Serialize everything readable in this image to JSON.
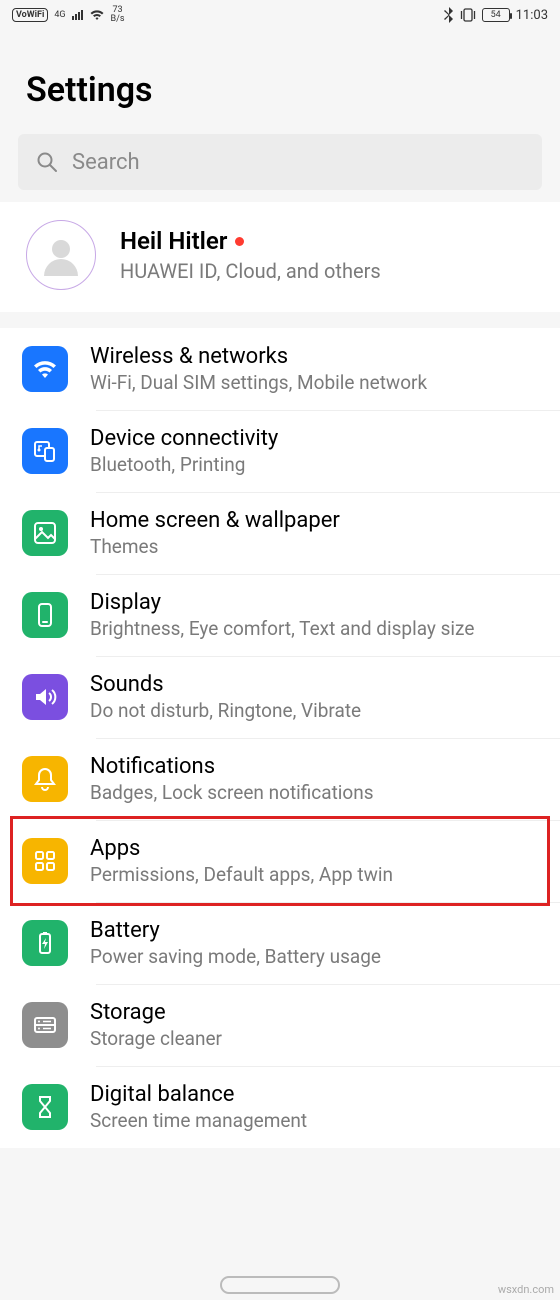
{
  "status": {
    "volte": "VoWiFi",
    "net_label": "4G",
    "speed_value": "73",
    "speed_unit": "B/s",
    "battery": "54",
    "time": "11:03"
  },
  "title": "Settings",
  "search": {
    "placeholder": "Search"
  },
  "account": {
    "name": "Heil Hitler",
    "subtitle": "HUAWEI ID, Cloud, and others"
  },
  "items": [
    {
      "id": "wireless",
      "icon": "wifi-icon",
      "color": "#1976ff",
      "title": "Wireless & networks",
      "subtitle": "Wi-Fi, Dual SIM settings, Mobile network"
    },
    {
      "id": "device-connectivity",
      "icon": "device-connectivity-icon",
      "color": "#1976ff",
      "title": "Device connectivity",
      "subtitle": "Bluetooth, Printing"
    },
    {
      "id": "home-screen",
      "icon": "wallpaper-icon",
      "color": "#21b36b",
      "title": "Home screen & wallpaper",
      "subtitle": "Themes"
    },
    {
      "id": "display",
      "icon": "display-icon",
      "color": "#21b36b",
      "title": "Display",
      "subtitle": "Brightness, Eye comfort, Text and display size"
    },
    {
      "id": "sounds",
      "icon": "sounds-icon",
      "color": "#7b4fe0",
      "title": "Sounds",
      "subtitle": "Do not disturb, Ringtone, Vibrate"
    },
    {
      "id": "notifications",
      "icon": "notifications-icon",
      "color": "#f7b500",
      "title": "Notifications",
      "subtitle": "Badges, Lock screen notifications"
    },
    {
      "id": "apps",
      "icon": "apps-icon",
      "color": "#f7b500",
      "title": "Apps",
      "subtitle": "Permissions, Default apps, App twin",
      "highlighted": true
    },
    {
      "id": "battery",
      "icon": "battery-icon",
      "color": "#21b36b",
      "title": "Battery",
      "subtitle": "Power saving mode, Battery usage"
    },
    {
      "id": "storage",
      "icon": "storage-icon",
      "color": "#8e8e8e",
      "title": "Storage",
      "subtitle": "Storage cleaner"
    },
    {
      "id": "digital-balance",
      "icon": "digital-balance-icon",
      "color": "#21b36b",
      "title": "Digital balance",
      "subtitle": "Screen time management"
    }
  ],
  "watermark": "wsxdn.com"
}
